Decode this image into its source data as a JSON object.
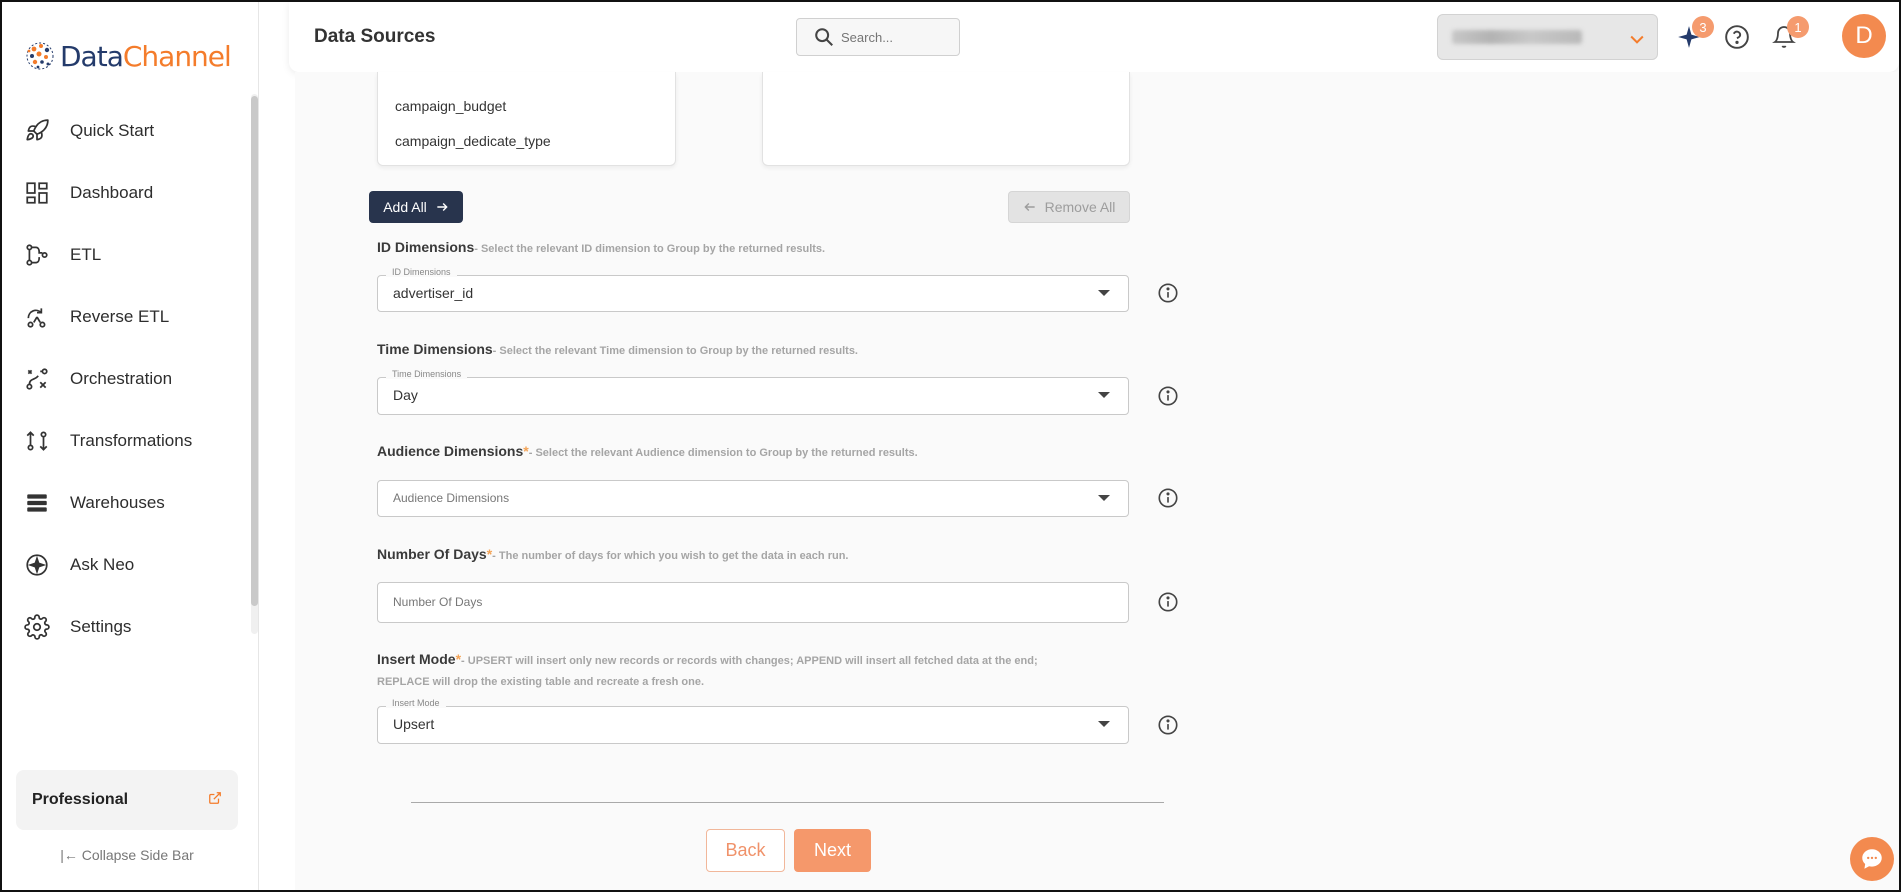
{
  "app": {
    "logo_part1": "Data",
    "logo_part2": "Channel"
  },
  "sidebar": {
    "items": [
      {
        "label": "Quick Start",
        "icon": "rocket-icon"
      },
      {
        "label": "Dashboard",
        "icon": "dashboard-icon"
      },
      {
        "label": "ETL",
        "icon": "etl-icon"
      },
      {
        "label": "Reverse ETL",
        "icon": "reverse-etl-icon"
      },
      {
        "label": "Orchestration",
        "icon": "orchestration-icon"
      },
      {
        "label": "Transformations",
        "icon": "transformations-icon"
      },
      {
        "label": "Warehouses",
        "icon": "warehouses-icon"
      },
      {
        "label": "Ask Neo",
        "icon": "ask-neo-icon"
      },
      {
        "label": "Settings",
        "icon": "gear-icon"
      }
    ],
    "plan_name": "Professional",
    "collapse_label": "Collapse Side Bar"
  },
  "header": {
    "title": "Data Sources",
    "search_placeholder": "Search...",
    "sparkle_badge": "3",
    "notification_badge": "1",
    "avatar_initial": "D"
  },
  "columns_box": {
    "items": [
      "campaign_budget",
      "campaign_dedicate_type"
    ]
  },
  "actions": {
    "add_all": "Add All",
    "remove_all": "Remove All"
  },
  "fields": {
    "id_dimensions": {
      "label": "ID Dimensions",
      "hint": "- Select the relevant ID dimension to Group by the returned results.",
      "floating": "ID Dimensions",
      "value": "advertiser_id"
    },
    "time_dimensions": {
      "label": "Time Dimensions",
      "hint": "- Select the relevant Time dimension to Group by the returned results.",
      "floating": "Time Dimensions",
      "value": "Day"
    },
    "audience_dimensions": {
      "label": "Audience Dimensions",
      "req": "*",
      "hint": "- Select the relevant Audience dimension to Group by the returned results.",
      "placeholder": "Audience Dimensions"
    },
    "number_of_days": {
      "label": "Number Of Days",
      "req": "*",
      "hint": "- The number of days for which you wish to get the data in each run.",
      "placeholder": "Number Of Days"
    },
    "insert_mode": {
      "label": "Insert Mode",
      "req": "*",
      "hint": "- UPSERT will insert only new records or records with changes; APPEND will insert all fetched data at the end; REPLACE will drop the existing table and recreate a fresh one.",
      "floating": "Insert Mode",
      "value": "Upsert"
    }
  },
  "footer": {
    "back": "Back",
    "next": "Next"
  },
  "colors": {
    "brand_navy": "#243b6b",
    "brand_orange": "#f47c2b",
    "button_dark": "#28344d",
    "accent_peach": "#f5986b"
  }
}
